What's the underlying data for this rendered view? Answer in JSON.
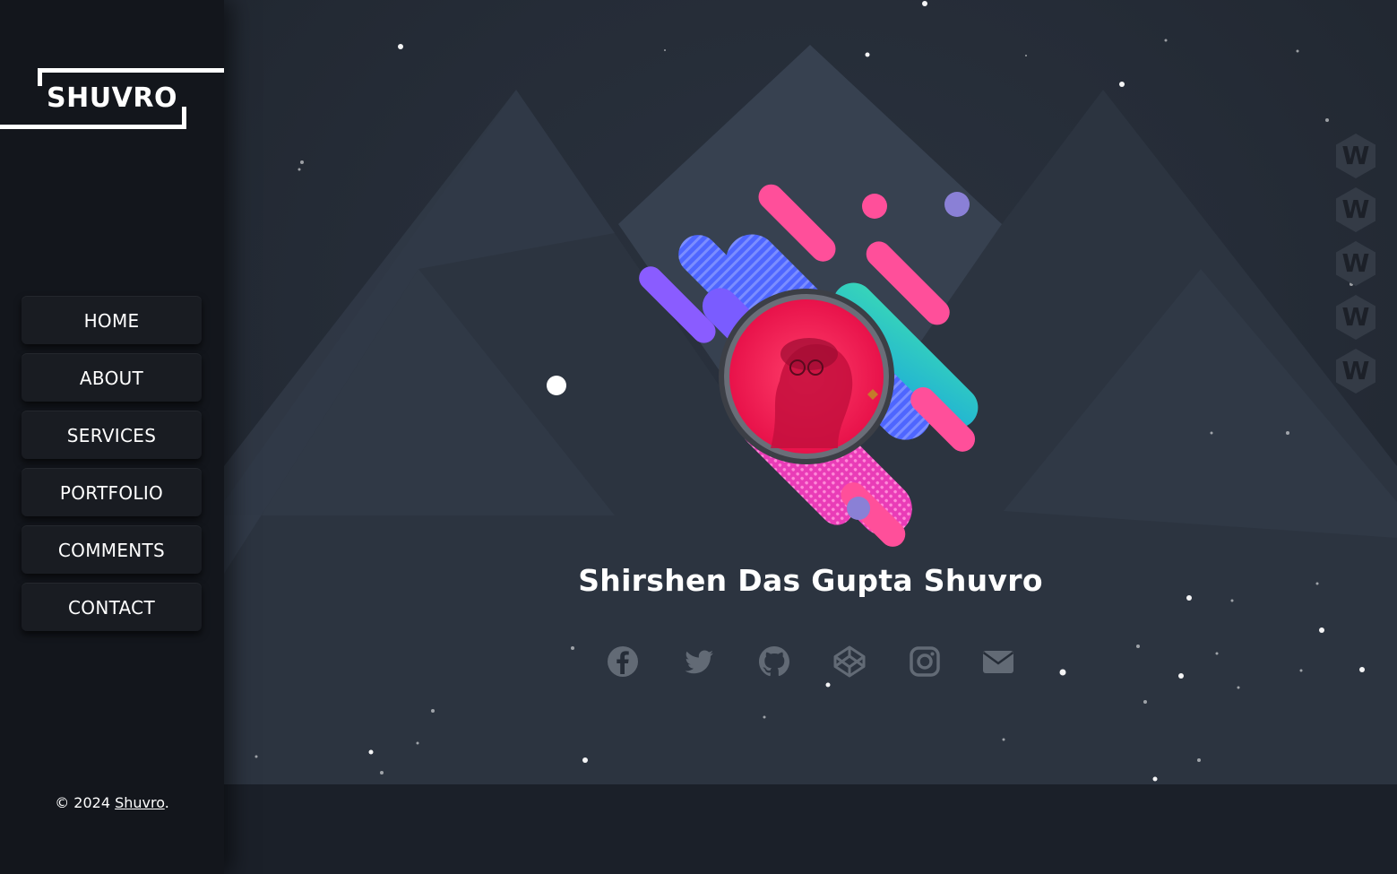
{
  "brand": {
    "logo_text": "SHUVRO"
  },
  "nav": {
    "items": [
      {
        "label": "HOME"
      },
      {
        "label": "ABOUT"
      },
      {
        "label": "SERVICES"
      },
      {
        "label": "PORTFOLIO"
      },
      {
        "label": "COMMENTS"
      },
      {
        "label": "CONTACT"
      }
    ]
  },
  "footer": {
    "copyright_prefix": "© 2024 ",
    "copyright_link": "Shuvro",
    "copyright_suffix": "."
  },
  "hero": {
    "name": "Shirshen Das Gupta Shuvro"
  },
  "socials": [
    {
      "icon": "facebook-icon"
    },
    {
      "icon": "twitter-icon"
    },
    {
      "icon": "github-icon"
    },
    {
      "icon": "codepen-icon"
    },
    {
      "icon": "instagram-icon"
    },
    {
      "icon": "envelope-icon"
    }
  ],
  "side_dots": [
    {
      "label": "W"
    },
    {
      "label": "W"
    },
    {
      "label": "W"
    },
    {
      "label": "W"
    },
    {
      "label": "W"
    }
  ],
  "colors": {
    "background": "#252c37",
    "sidebar": "#13161c",
    "accent_pink": "#ff4f9a",
    "accent_teal": "#2ad4c4",
    "accent_blue": "#4f6cff",
    "icon_gray": "#626a75"
  }
}
